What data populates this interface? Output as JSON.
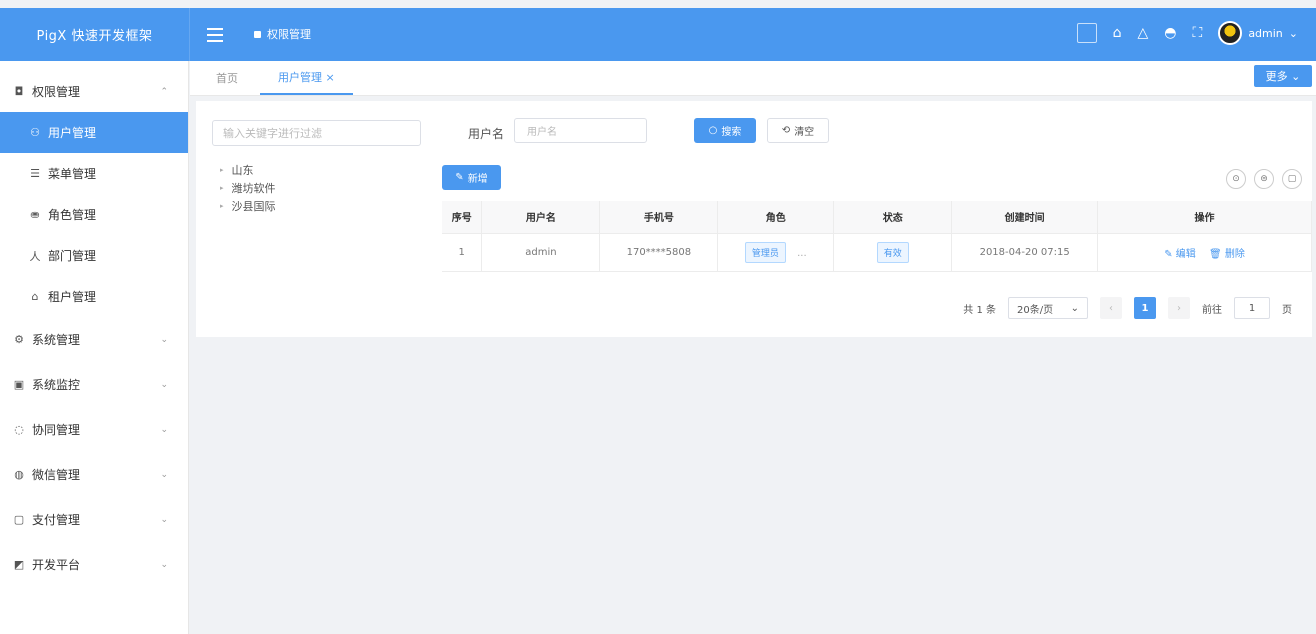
{
  "header": {
    "logo": "PigX 快速开发框架",
    "breadcrumb": "权限管理",
    "user": "admin",
    "user_arrow": "⌄"
  },
  "sidebar": {
    "items": [
      {
        "label": "权限管理",
        "icon": "◘",
        "arrow": "⌃"
      },
      {
        "label": "用户管理",
        "icon": "⚇"
      },
      {
        "label": "菜单管理",
        "icon": "☰"
      },
      {
        "label": "角色管理",
        "icon": "⛂"
      },
      {
        "label": "部门管理",
        "icon": "⼈"
      },
      {
        "label": "租户管理",
        "icon": "⌂"
      },
      {
        "label": "系统管理",
        "icon": "⚙",
        "arrow": "⌄"
      },
      {
        "label": "系统监控",
        "icon": "▣",
        "arrow": "⌄"
      },
      {
        "label": "协同管理",
        "icon": "◌",
        "arrow": "⌄"
      },
      {
        "label": "微信管理",
        "icon": "◍",
        "arrow": "⌄"
      },
      {
        "label": "支付管理",
        "icon": "▢",
        "arrow": "⌄"
      },
      {
        "label": "开发平台",
        "icon": "◩",
        "arrow": "⌄"
      }
    ]
  },
  "tabs": {
    "items": [
      {
        "label": "首页"
      },
      {
        "label": "用户管理 ×"
      }
    ],
    "more": "更多 ⌄"
  },
  "tree": {
    "placeholder": "输入关键字进行过滤",
    "nodes": [
      "山东",
      "潍坊软件",
      "沙县国际"
    ],
    "node_arrow": "▸"
  },
  "filter": {
    "label": "用户名",
    "placeholder": "用户名",
    "search": "搜索",
    "search_icon": "○",
    "reset": "清空",
    "reset_icon": "⟲"
  },
  "toolbar": {
    "add": "新增",
    "add_icon": "✎",
    "icons": [
      "⊙",
      "⊜",
      "▢"
    ]
  },
  "table": {
    "columns": [
      "序号",
      "用户名",
      "手机号",
      "角色",
      "状态",
      "创建时间",
      "操作"
    ],
    "rows": [
      {
        "index": "1",
        "username": "admin",
        "phone": "170****5808",
        "role": "管理员",
        "role_more": "...",
        "status": "有效",
        "created": "2018-04-20 07:15",
        "edit": "编辑",
        "delete": "删除",
        "edit_icon": "✎",
        "delete_icon": "🗑"
      }
    ]
  },
  "pager": {
    "total": "共 1 条",
    "size": "20条/页",
    "size_arrow": "⌄",
    "prev": "‹",
    "current": "1",
    "next": "›",
    "goto": "前往",
    "goto_value": "1",
    "page_suffix": "页"
  },
  "colors": {
    "accent": "#4a98ef",
    "sidebar_active": "#4a98ef"
  }
}
